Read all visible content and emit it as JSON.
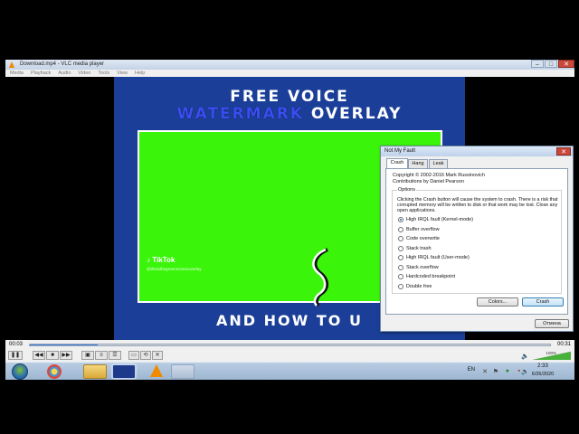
{
  "window": {
    "title": "Download.mp4 - VLC media player",
    "controls": {
      "minimize": "–",
      "maximize": "□",
      "close": "✕"
    }
  },
  "menu": [
    "Media",
    "Playback",
    "Audio",
    "Video",
    "Tools",
    "View",
    "Help"
  ],
  "video": {
    "line1": "FREE VOICE",
    "line2_blue": "WATERMARK",
    "line2_white": "OVERLAY",
    "bottom_line": "AND HOW TO U",
    "tiktok_brand": "TikTok",
    "tiktok_user": "@thisisthegreenscreenoverlay",
    "background_color": "#1b3f99",
    "screen_color": "#3af50a"
  },
  "player": {
    "time_elapsed": "00:03",
    "time_total": "00:31",
    "progress_fraction": 0.13,
    "volume_label": "100%",
    "volume_fraction": 1.0
  },
  "dialog": {
    "title": "Not My Fault",
    "tabs": [
      "Crash",
      "Hang",
      "Leak"
    ],
    "active_tab": "Crash",
    "copyright": "Copyright © 2002-2016 Mark Russinovich",
    "contributions": "Contributions by Daniel Pearson",
    "options_label": "Options",
    "description": "Clicking the Crash button will cause the system to crash. There is a risk that corrupted memory will be written to disk or that work may be lost. Close any open applications.",
    "options": [
      "High IRQL fault (Kernel-mode)",
      "Buffer overflow",
      "Code overwrite",
      "Stack trash",
      "High IRQL fault (User-mode)",
      "Stack overflow",
      "Hardcoded breakpoint",
      "Double free"
    ],
    "selected_option": 0,
    "colors_button": "Colors...",
    "crash_button": "Crash",
    "cancel_button": "Отмена"
  },
  "taskbar": {
    "language": "EN",
    "time": "2:33",
    "date": "6/26/2020"
  }
}
